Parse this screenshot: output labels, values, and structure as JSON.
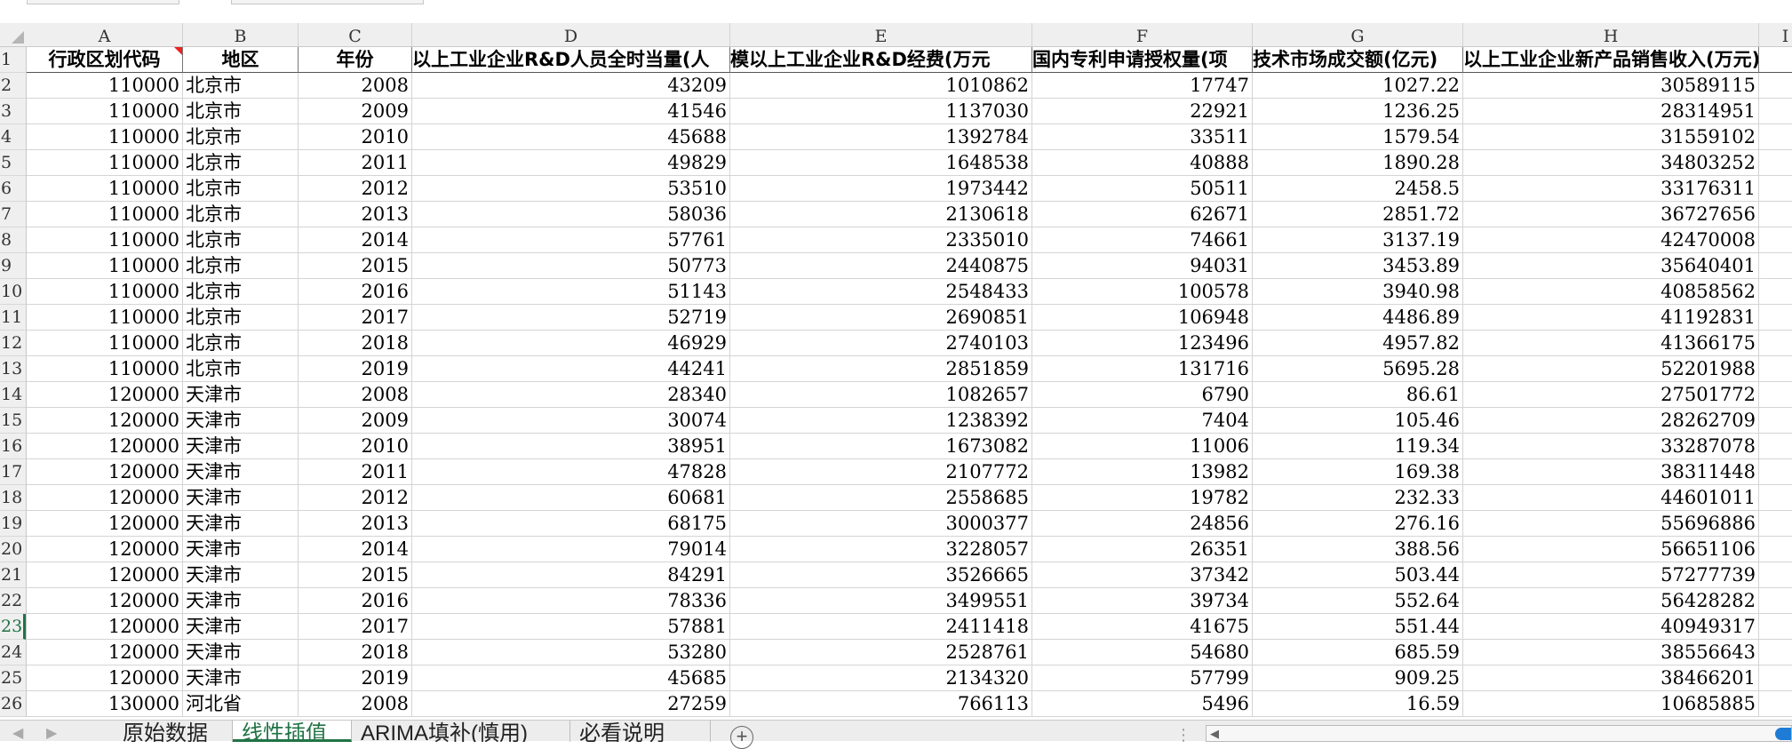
{
  "columns": [
    "A",
    "B",
    "C",
    "D",
    "E",
    "F",
    "G",
    "H",
    "I"
  ],
  "headers": [
    "行政区划代码",
    "地区",
    "年份",
    "以上工业企业R&D人员全时当量(人",
    "模以上工业企业R&D经费(万元",
    "国内专利申请授权量(项",
    "技术市场成交额(亿元)",
    "以上工业企业新产品销售收入(万元)"
  ],
  "rows": [
    [
      "110000",
      "北京市",
      "2008",
      "43209",
      "1010862",
      "17747",
      "1027.22",
      "30589115"
    ],
    [
      "110000",
      "北京市",
      "2009",
      "41546",
      "1137030",
      "22921",
      "1236.25",
      "28314951"
    ],
    [
      "110000",
      "北京市",
      "2010",
      "45688",
      "1392784",
      "33511",
      "1579.54",
      "31559102"
    ],
    [
      "110000",
      "北京市",
      "2011",
      "49829",
      "1648538",
      "40888",
      "1890.28",
      "34803252"
    ],
    [
      "110000",
      "北京市",
      "2012",
      "53510",
      "1973442",
      "50511",
      "2458.5",
      "33176311"
    ],
    [
      "110000",
      "北京市",
      "2013",
      "58036",
      "2130618",
      "62671",
      "2851.72",
      "36727656"
    ],
    [
      "110000",
      "北京市",
      "2014",
      "57761",
      "2335010",
      "74661",
      "3137.19",
      "42470008"
    ],
    [
      "110000",
      "北京市",
      "2015",
      "50773",
      "2440875",
      "94031",
      "3453.89",
      "35640401"
    ],
    [
      "110000",
      "北京市",
      "2016",
      "51143",
      "2548433",
      "100578",
      "3940.98",
      "40858562"
    ],
    [
      "110000",
      "北京市",
      "2017",
      "52719",
      "2690851",
      "106948",
      "4486.89",
      "41192831"
    ],
    [
      "110000",
      "北京市",
      "2018",
      "46929",
      "2740103",
      "123496",
      "4957.82",
      "41366175"
    ],
    [
      "110000",
      "北京市",
      "2019",
      "44241",
      "2851859",
      "131716",
      "5695.28",
      "52201988"
    ],
    [
      "120000",
      "天津市",
      "2008",
      "28340",
      "1082657",
      "6790",
      "86.61",
      "27501772"
    ],
    [
      "120000",
      "天津市",
      "2009",
      "30074",
      "1238392",
      "7404",
      "105.46",
      "28262709"
    ],
    [
      "120000",
      "天津市",
      "2010",
      "38951",
      "1673082",
      "11006",
      "119.34",
      "33287078"
    ],
    [
      "120000",
      "天津市",
      "2011",
      "47828",
      "2107772",
      "13982",
      "169.38",
      "38311448"
    ],
    [
      "120000",
      "天津市",
      "2012",
      "60681",
      "2558685",
      "19782",
      "232.33",
      "44601011"
    ],
    [
      "120000",
      "天津市",
      "2013",
      "68175",
      "3000377",
      "24856",
      "276.16",
      "55696886"
    ],
    [
      "120000",
      "天津市",
      "2014",
      "79014",
      "3228057",
      "26351",
      "388.56",
      "56651106"
    ],
    [
      "120000",
      "天津市",
      "2015",
      "84291",
      "3526665",
      "37342",
      "503.44",
      "57277739"
    ],
    [
      "120000",
      "天津市",
      "2016",
      "78336",
      "3499551",
      "39734",
      "552.64",
      "56428282"
    ],
    [
      "120000",
      "天津市",
      "2017",
      "57881",
      "2411418",
      "41675",
      "551.44",
      "40949317"
    ],
    [
      "120000",
      "天津市",
      "2018",
      "53280",
      "2528761",
      "54680",
      "685.59",
      "38556643"
    ],
    [
      "120000",
      "天津市",
      "2019",
      "45685",
      "2134320",
      "57799",
      "909.25",
      "38466201"
    ],
    [
      "130000",
      "河北省",
      "2008",
      "27259",
      "766113",
      "5496",
      "16.59",
      "10685885"
    ]
  ],
  "active_row": 23,
  "sheet_tabs": [
    "原始数据",
    "线性插值",
    "ARIMA填补(慎用)",
    "必看说明"
  ],
  "active_tab": "线性插值",
  "add_sheet_symbol": "+",
  "colors": {
    "accent": "#217346",
    "grid": "#d4d4d4",
    "header_bg": "#efefef",
    "comment_marker": "#e22222",
    "scroll_thumb": "#1e7bd6"
  },
  "icons": [
    "select-all-icon",
    "comment-indicator-icon",
    "prev-sheet-icon",
    "next-sheet-icon",
    "add-sheet-icon",
    "more-options-icon",
    "scroll-left-icon"
  ]
}
